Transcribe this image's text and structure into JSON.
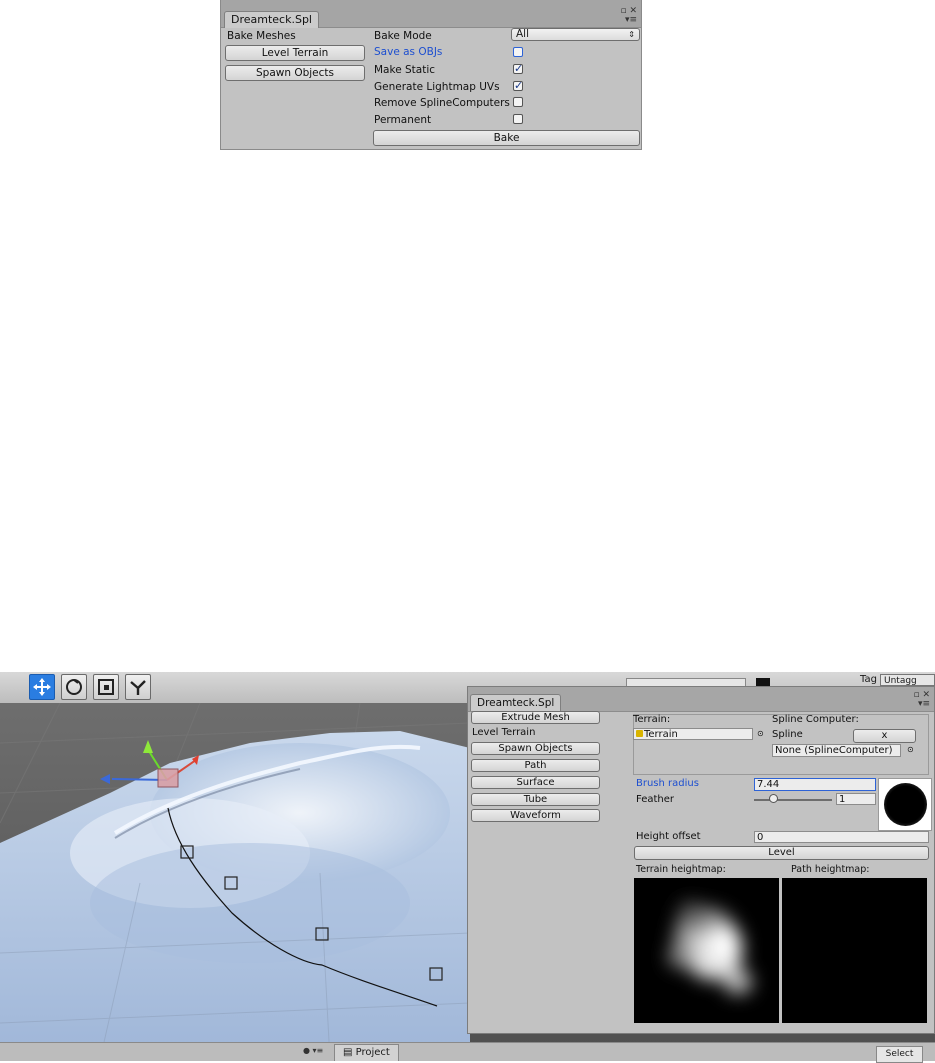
{
  "top_window": {
    "tab": "Dreamteck.Spl",
    "section": "Bake Meshes",
    "buttons": [
      "Level Terrain",
      "Spawn Objects"
    ],
    "bake_mode_label": "Bake Mode",
    "bake_mode_value": "All",
    "options": [
      {
        "label": "Save as OBJs",
        "checked": false
      },
      {
        "label": "Make Static",
        "checked": true
      },
      {
        "label": "Generate Lightmap UVs",
        "checked": true
      },
      {
        "label": "Remove SplineComputers",
        "checked": false
      },
      {
        "label": "Permanent",
        "checked": false
      }
    ],
    "bake_button": "Bake"
  },
  "scene": {
    "tools": [
      "move-tool",
      "rotate-tool",
      "scale-tool",
      "spline-tool"
    ],
    "header_right": {
      "tag_label": "Tag",
      "tag_value": "Untagg"
    },
    "bottom_tab": "Project",
    "bottom_right": "Select"
  },
  "inspector": {
    "tab": "Dreamteck.Spl",
    "left_menu": {
      "extrude": "Extrude Mesh",
      "current": "Level Terrain",
      "items": [
        "Spawn Objects",
        "Path",
        "Surface",
        "Tube",
        "Waveform"
      ]
    },
    "terrain_label": "Terrain:",
    "terrain_value": "Terrain",
    "spline_computer_label": "Spline Computer:",
    "spline_label": "Spline",
    "spline_x_button": "x",
    "spline_value": "None (SplineComputer)",
    "brush_radius_label": "Brush radius",
    "brush_radius_value": "7.44",
    "feather_label": "Feather",
    "feather_value": "1",
    "feather_slider_fraction": 0.2,
    "height_offset_label": "Height offset",
    "height_offset_value": "0",
    "level_button": "Level",
    "terrain_heightmap_label": "Terrain heightmap:",
    "path_heightmap_label": "Path heightmap:"
  },
  "colors": {
    "panel": "#c2c2c2",
    "accent_blue": "#2a7de1",
    "terrain": "#b8cbe4"
  }
}
